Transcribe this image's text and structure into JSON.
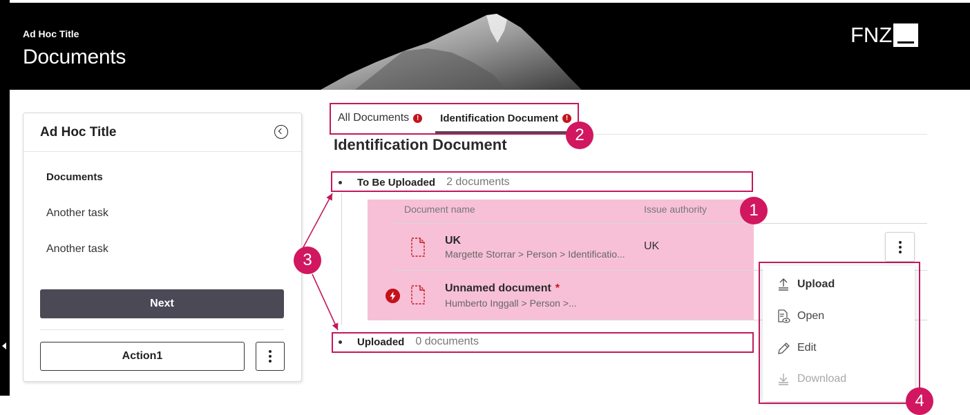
{
  "header": {
    "sub_title": "Ad Hoc Title",
    "title": "Documents",
    "logo_text": "FNZ"
  },
  "panel": {
    "title": "Ad Hoc Title",
    "tasks": [
      "Documents",
      "Another task",
      "Another task"
    ],
    "next_label": "Next",
    "action_label": "Action1"
  },
  "tabs": [
    {
      "label": "All Documents",
      "alert": "!"
    },
    {
      "label": "Identification Document",
      "alert": "!"
    }
  ],
  "section_title": "Identification Document",
  "groups": {
    "to_be_uploaded": {
      "name": "To Be Uploaded",
      "count": "2 documents"
    },
    "uploaded": {
      "name": "Uploaded",
      "count": "0 documents"
    }
  },
  "table": {
    "columns": [
      "Document name",
      "Issue authority"
    ],
    "rows": [
      {
        "name": "UK",
        "required": "",
        "path": "Margette Storrar > Person > Identificatio...",
        "authority": "UK"
      },
      {
        "name": "Unnamed document",
        "required": "*",
        "path": "Humberto Inggall > Person >...",
        "authority": ""
      }
    ]
  },
  "menu": {
    "items": [
      "Upload",
      "Open",
      "Edit",
      "Download"
    ]
  },
  "annotations": [
    "1",
    "2",
    "3",
    "4"
  ],
  "colors": {
    "header_bg": "#000000",
    "primary_button": "#4c4956",
    "alert_red": "#c4121c",
    "annotation_pink": "#d1175f",
    "highlight_pink": "#f7c0d6"
  },
  "icons": [
    "chevron-left-icon",
    "more-vertical-icon",
    "alert-icon",
    "document-icon",
    "lightning-warning-icon",
    "upload-icon",
    "open-document-icon",
    "edit-pencil-icon",
    "download-icon"
  ]
}
